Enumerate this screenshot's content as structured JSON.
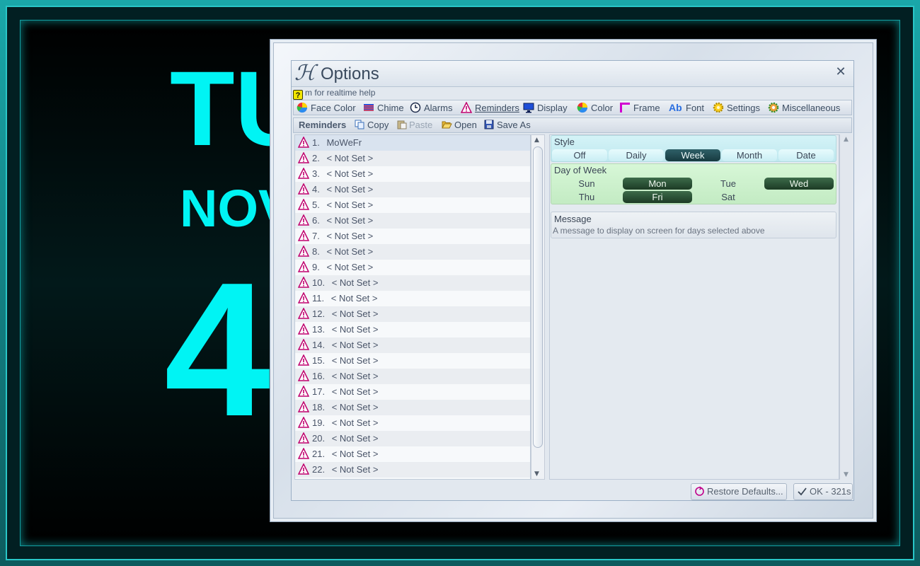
{
  "clock": {
    "day": "TU",
    "month": "NOV",
    "number": "4"
  },
  "dialog": {
    "title": "Options",
    "help_text": "m for realtime help",
    "close_glyph": "✕"
  },
  "tabs": [
    {
      "label": "Face Color",
      "icon": "pie-chart-icon"
    },
    {
      "label": "Chime",
      "icon": "flag-icon"
    },
    {
      "label": "Alarms",
      "icon": "clock-icon"
    },
    {
      "label": "Reminders",
      "icon": "warning-icon",
      "active": true
    },
    {
      "label": "Display",
      "icon": "monitor-icon"
    },
    {
      "label": "Color",
      "icon": "pie-chart-icon"
    },
    {
      "label": "Frame",
      "icon": "frame-icon"
    },
    {
      "label": "Font",
      "icon": "font-icon",
      "glyph": "Ab"
    },
    {
      "label": "Settings",
      "icon": "gear-icon"
    },
    {
      "label": "Miscellaneous",
      "icon": "gears-icon"
    }
  ],
  "toolbar": {
    "title": "Reminders",
    "copy": "Copy",
    "paste": "Paste",
    "open": "Open",
    "save_as": "Save As"
  },
  "reminders": [
    {
      "num": "1.",
      "text": "MoWeFr"
    },
    {
      "num": "2.",
      "text": "< Not Set >"
    },
    {
      "num": "3.",
      "text": "< Not Set >"
    },
    {
      "num": "4.",
      "text": "< Not Set >"
    },
    {
      "num": "5.",
      "text": "< Not Set >"
    },
    {
      "num": "6.",
      "text": "< Not Set >"
    },
    {
      "num": "7.",
      "text": "< Not Set >"
    },
    {
      "num": "8.",
      "text": "< Not Set >"
    },
    {
      "num": "9.",
      "text": "< Not Set >"
    },
    {
      "num": "10.",
      "text": "< Not Set >"
    },
    {
      "num": "11.",
      "text": "< Not Set >"
    },
    {
      "num": "12.",
      "text": "< Not Set >"
    },
    {
      "num": "13.",
      "text": "< Not Set >"
    },
    {
      "num": "14.",
      "text": "< Not Set >"
    },
    {
      "num": "15.",
      "text": "< Not Set >"
    },
    {
      "num": "16.",
      "text": "< Not Set >"
    },
    {
      "num": "17.",
      "text": "< Not Set >"
    },
    {
      "num": "18.",
      "text": "< Not Set >"
    },
    {
      "num": "19.",
      "text": "< Not Set >"
    },
    {
      "num": "20.",
      "text": "< Not Set >"
    },
    {
      "num": "21.",
      "text": "< Not Set >"
    },
    {
      "num": "22.",
      "text": "< Not Set >"
    }
  ],
  "style": {
    "title": "Style",
    "options": [
      "Off",
      "Daily",
      "Week",
      "Month",
      "Date"
    ],
    "selected": "Week"
  },
  "day_of_week": {
    "title": "Day of Week",
    "days": [
      {
        "label": "Sun",
        "on": false
      },
      {
        "label": "Mon",
        "on": true
      },
      {
        "label": "Tue",
        "on": false
      },
      {
        "label": "Wed",
        "on": true
      },
      {
        "label": "Thu",
        "on": false
      },
      {
        "label": "Fri",
        "on": true
      },
      {
        "label": "Sat",
        "on": false
      }
    ]
  },
  "message": {
    "title": "Message",
    "value": "A message to display on screen for days selected above"
  },
  "buttons": {
    "restore": "Restore Defaults...",
    "ok": "OK - 321s"
  },
  "colors": {
    "clock_digits": "#00f4f4",
    "accent_on_style": "#173a40",
    "accent_on_day": "#1c3b25",
    "warning": "#c0006e"
  }
}
